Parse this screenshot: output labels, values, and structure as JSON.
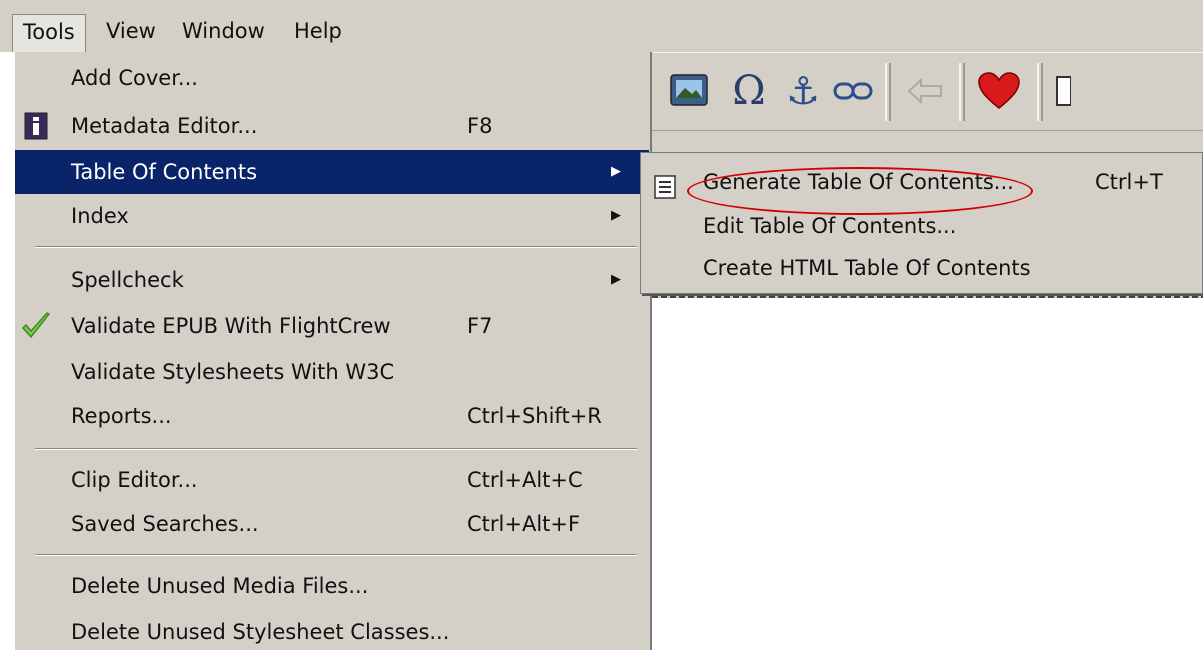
{
  "menubar": {
    "items": [
      "Tools",
      "View",
      "Window",
      "Help"
    ]
  },
  "tools_menu": {
    "items": [
      {
        "label": "Add Cover...",
        "shortcut": "",
        "icon": ""
      },
      {
        "label": "Metadata Editor...",
        "shortcut": "F8",
        "icon": "info-book-icon"
      },
      {
        "label": "Table Of Contents",
        "shortcut": "",
        "icon": "",
        "submenu": true,
        "highlighted": true
      },
      {
        "label": "Index",
        "shortcut": "",
        "icon": "",
        "submenu": true
      },
      {
        "label": "Spellcheck",
        "shortcut": "",
        "icon": "",
        "submenu": true
      },
      {
        "label": "Validate EPUB With FlightCrew",
        "shortcut": "F7",
        "icon": "checkmark-icon"
      },
      {
        "label": "Validate Stylesheets With W3C",
        "shortcut": "",
        "icon": ""
      },
      {
        "label": "Reports...",
        "shortcut": "Ctrl+Shift+R",
        "icon": ""
      },
      {
        "label": "Clip Editor...",
        "shortcut": "Ctrl+Alt+C",
        "icon": ""
      },
      {
        "label": "Saved Searches...",
        "shortcut": "Ctrl+Alt+F",
        "icon": ""
      },
      {
        "label": "Delete Unused Media Files...",
        "shortcut": "",
        "icon": ""
      },
      {
        "label": "Delete Unused Stylesheet Classes...",
        "shortcut": "",
        "icon": ""
      }
    ]
  },
  "toc_submenu": {
    "items": [
      {
        "label": "Generate Table Of Contents...",
        "shortcut": "Ctrl+T",
        "icon": "toc-list-icon"
      },
      {
        "label": "Edit Table Of Contents...",
        "shortcut": ""
      },
      {
        "label": "Create HTML Table Of Contents",
        "shortcut": ""
      }
    ]
  },
  "colors": {
    "menu_bg": "#d4d0c8",
    "highlight": "#0a246a",
    "annotation": "#d40000"
  },
  "toolbar_icons": [
    "image-icon",
    "omega-icon",
    "anchor-icon",
    "link-icon",
    "back-arrow-icon",
    "heart-icon"
  ]
}
